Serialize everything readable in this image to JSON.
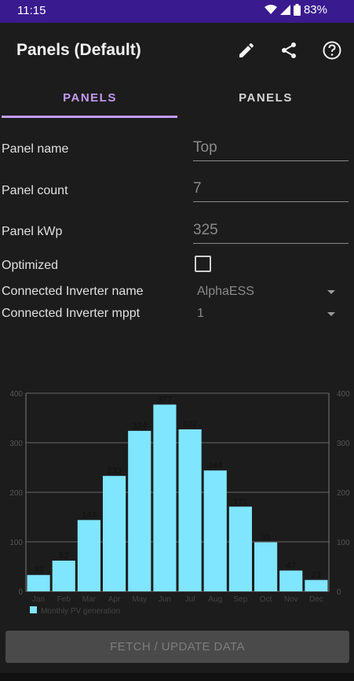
{
  "status": {
    "time": "11:15",
    "battery": "83%"
  },
  "appbar": {
    "title": "Panels (Default)",
    "icons": [
      "edit-icon",
      "share-icon",
      "help-icon"
    ]
  },
  "tabs": [
    {
      "label": "PANELS",
      "active": true
    },
    {
      "label": "PANELS",
      "active": false
    }
  ],
  "form": {
    "panel_name_label": "Panel name",
    "panel_name_value": "Top",
    "panel_count_label": "Panel count",
    "panel_count_value": "7",
    "panel_kwp_label": "Panel kWp",
    "panel_kwp_value": "325",
    "optimized_label": "Optimized",
    "optimized_checked": false,
    "inverter_name_label": "Connected Inverter name",
    "inverter_name_value": "AlphaESS",
    "inverter_mppt_label": "Connected Inverter mppt",
    "inverter_mppt_value": "1"
  },
  "chart_data": {
    "type": "bar",
    "categories": [
      "Jan",
      "Feb",
      "Mar",
      "Apr",
      "May",
      "Jun",
      "Jul",
      "Aug",
      "Sep",
      "Oct",
      "Nov",
      "Dec"
    ],
    "series": [
      {
        "name": "Monthly PV generation",
        "values": [
          33,
          62,
          144,
          233,
          324,
          377,
          327,
          244,
          171,
          99,
          42,
          23
        ]
      }
    ],
    "ylim": [
      0,
      400
    ],
    "yticks": [
      0,
      100,
      200,
      300,
      400
    ],
    "grid": true,
    "legend": "bottom-left",
    "colors": {
      "bar": "#80e5ff",
      "grid": "#666666"
    }
  },
  "button": {
    "label": "FETCH / UPDATE DATA"
  }
}
